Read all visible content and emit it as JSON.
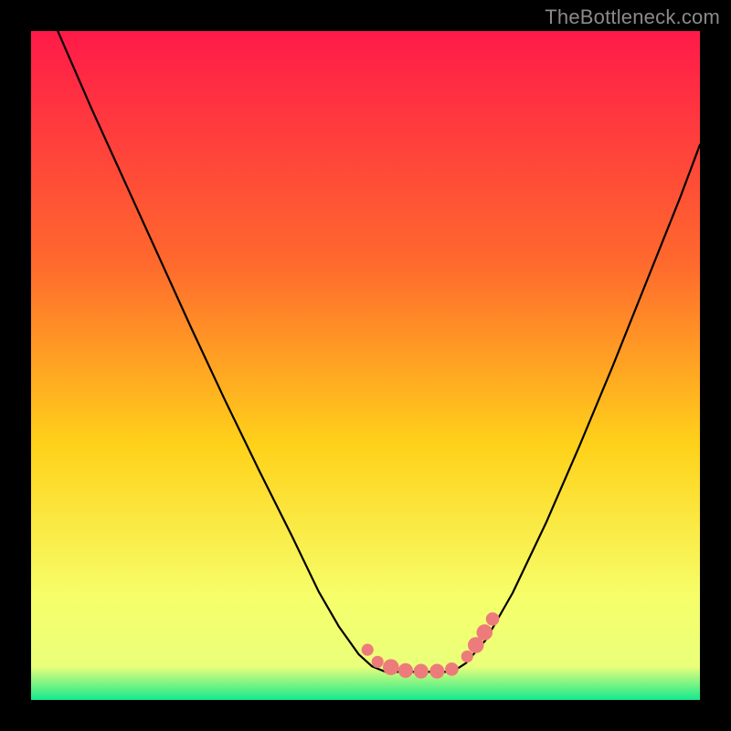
{
  "watermark": "TheBottleneck.com",
  "colors": {
    "gradient_top": "#ff1a49",
    "gradient_mid_high": "#ff6a2d",
    "gradient_mid": "#ffd21a",
    "gradient_low": "#f6ff6b",
    "gradient_tip_yellow": "#eaff7a",
    "gradient_tip_green": "#14e98d",
    "curve": "#000000",
    "marker_fill": "#ed7b7b",
    "marker_stroke": "#ed7b7b"
  },
  "chart_data": {
    "type": "line",
    "title": "",
    "xlabel": "",
    "ylabel": "",
    "xlim": [
      0,
      1
    ],
    "ylim": [
      0,
      1
    ],
    "curve_left": {
      "x": [
        0.04,
        0.09,
        0.14,
        0.19,
        0.24,
        0.29,
        0.34,
        0.39,
        0.43,
        0.46,
        0.49,
        0.51,
        0.53
      ],
      "y": [
        1.0,
        0.885,
        0.775,
        0.665,
        0.555,
        0.448,
        0.345,
        0.245,
        0.162,
        0.11,
        0.068,
        0.05,
        0.042
      ]
    },
    "flat_valley": {
      "x": [
        0.53,
        0.555,
        0.58,
        0.605,
        0.63
      ],
      "y": [
        0.042,
        0.042,
        0.042,
        0.042,
        0.042
      ]
    },
    "curve_right": {
      "x": [
        0.63,
        0.65,
        0.68,
        0.72,
        0.77,
        0.82,
        0.87,
        0.92,
        0.97,
        1.0
      ],
      "y": [
        0.042,
        0.055,
        0.09,
        0.16,
        0.265,
        0.38,
        0.5,
        0.625,
        0.75,
        0.83
      ]
    },
    "markers": [
      {
        "x": 0.503,
        "y": 0.075,
        "r": 0.009
      },
      {
        "x": 0.518,
        "y": 0.057,
        "r": 0.009
      },
      {
        "x": 0.538,
        "y": 0.049,
        "r": 0.012
      },
      {
        "x": 0.56,
        "y": 0.044,
        "r": 0.011
      },
      {
        "x": 0.583,
        "y": 0.043,
        "r": 0.011
      },
      {
        "x": 0.607,
        "y": 0.043,
        "r": 0.011
      },
      {
        "x": 0.629,
        "y": 0.046,
        "r": 0.01
      },
      {
        "x": 0.652,
        "y": 0.065,
        "r": 0.009
      },
      {
        "x": 0.665,
        "y": 0.082,
        "r": 0.012
      },
      {
        "x": 0.678,
        "y": 0.101,
        "r": 0.012
      },
      {
        "x": 0.69,
        "y": 0.121,
        "r": 0.01
      }
    ]
  }
}
